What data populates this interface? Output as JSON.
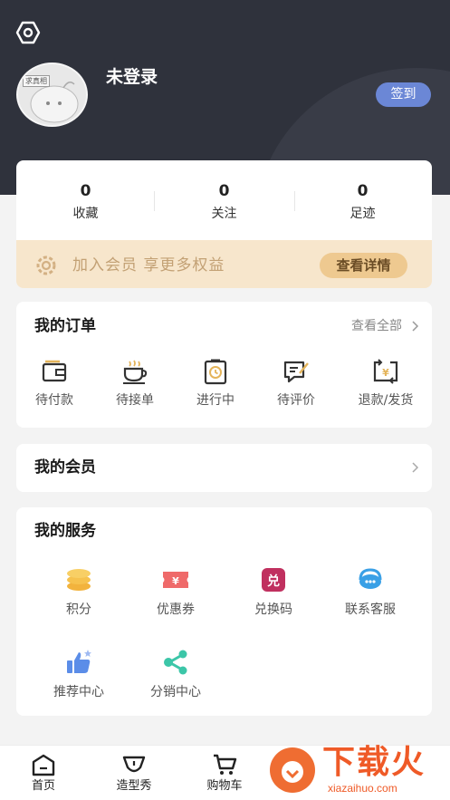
{
  "header": {
    "username": "未登录",
    "checkin_label": "签到",
    "avatar_tag": "求真相"
  },
  "stats": [
    {
      "value": "0",
      "label": "收藏"
    },
    {
      "value": "0",
      "label": "关注"
    },
    {
      "value": "0",
      "label": "足迹"
    }
  ],
  "member_banner": {
    "text": "加入会员 享更多权益",
    "button_label": "查看详情"
  },
  "orders": {
    "title": "我的订单",
    "view_all": "查看全部",
    "items": [
      {
        "label": "待付款",
        "icon": "wallet-icon"
      },
      {
        "label": "待接单",
        "icon": "coffee-cup-icon"
      },
      {
        "label": "进行中",
        "icon": "clipboard-clock-icon"
      },
      {
        "label": "待评价",
        "icon": "review-pen-icon"
      },
      {
        "label": "退款/发货",
        "icon": "refund-yen-icon"
      }
    ]
  },
  "vip": {
    "title": "我的会员"
  },
  "services": {
    "title": "我的服务",
    "items": [
      {
        "label": "积分",
        "icon": "coins-icon"
      },
      {
        "label": "优惠券",
        "icon": "coupon-icon"
      },
      {
        "label": "兑换码",
        "icon": "redeem-code-icon"
      },
      {
        "label": "联系客服",
        "icon": "headset-icon"
      },
      {
        "label": "推荐中心",
        "icon": "thumbs-up-icon"
      },
      {
        "label": "分销中心",
        "icon": "share-icon"
      }
    ]
  },
  "tabbar": [
    {
      "label": "首页",
      "icon": "home-icon"
    },
    {
      "label": "造型秀",
      "icon": "show-icon"
    },
    {
      "label": "购物车",
      "icon": "cart-icon"
    }
  ],
  "watermark": {
    "text": "下载火",
    "url_text": "xiazaihuo.com"
  },
  "colors": {
    "header_bg": "#2f323c",
    "checkin_btn": "#6b87d6",
    "member_bg": "#f7e6cc",
    "member_btn": "#eec990",
    "coins": "#f2b33d",
    "coupon": "#ef6a6a",
    "redeem": "#c0305f",
    "headset": "#3aa0e6",
    "thumbs": "#5b8de8",
    "share": "#3cc6a8",
    "watermark": "#ef5a27"
  }
}
